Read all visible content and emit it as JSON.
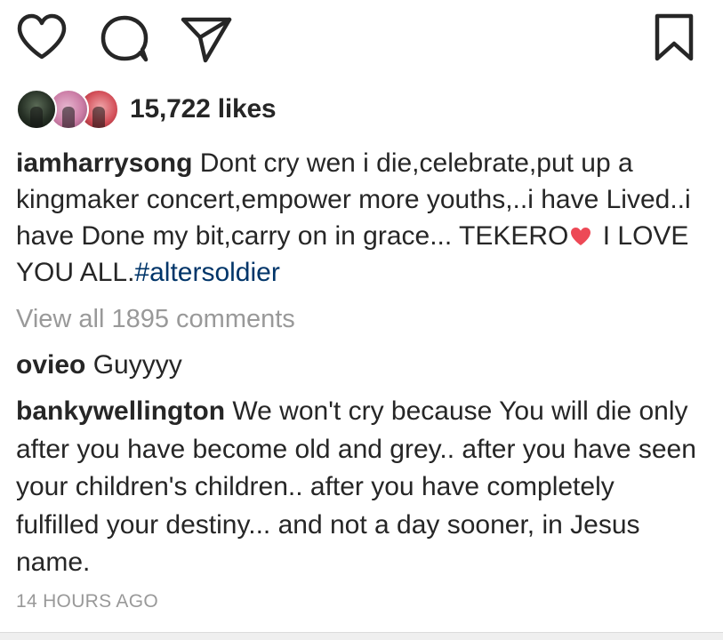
{
  "actions": {
    "like_icon": "heart-outline",
    "comment_icon": "speech-bubble",
    "share_icon": "paper-plane",
    "save_icon": "bookmark-outline"
  },
  "likes": {
    "count_text": "15,722 likes"
  },
  "caption": {
    "username": "iamharrysong",
    "text_before_emoji": "Dont cry wen i die,celebrate,put up a kingmaker concert,empower more youths,..i have Lived..i have Done my bit,carry on in grace... TEKERO",
    "emoji": "red-heart",
    "text_after_emoji": " I LOVE YOU ALL.",
    "hashtag": "#altersoldier"
  },
  "view_all_comments": "View all 1895 comments",
  "comments": [
    {
      "username": "ovieo",
      "text": "Guyyyy"
    },
    {
      "username": "bankywellington",
      "text": "We won't cry because You will die only after you have become old and grey.. after you have seen your children's children.. after you have completely fulfilled your destiny... and not a day sooner, in Jesus name."
    }
  ],
  "timestamp": "14 HOURS AGO",
  "colors": {
    "text": "#262626",
    "muted": "#999999",
    "hashtag": "#003569",
    "heart": "#ed4956"
  }
}
